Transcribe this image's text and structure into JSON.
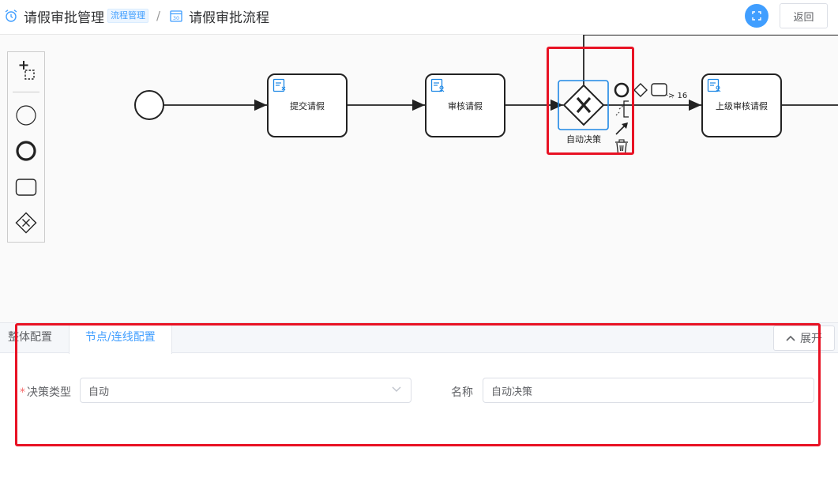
{
  "breadcrumb": {
    "title": "请假审批管理",
    "tag": "流程管理",
    "separator": "/",
    "current": "请假审批流程"
  },
  "header": {
    "back_label": "返回"
  },
  "diagram": {
    "nodes": {
      "task1": "提交请假",
      "task2": "审核请假",
      "gateway": "自动决策",
      "task3": "上级审核请假"
    },
    "context_pad_count": "> 16"
  },
  "palette": {
    "tools": [
      "hand-tool-icon",
      "start-event-icon",
      "end-event-icon",
      "task-icon",
      "gateway-icon"
    ]
  },
  "panel": {
    "tabs": [
      "整体配置",
      "节点/连线配置"
    ],
    "active_tab": "节点/连线配置",
    "expand_label": "展开",
    "decision_type_label": "决策类型",
    "decision_type_value": "自动",
    "name_label": "名称",
    "name_value": "自动决策"
  },
  "colors": {
    "accent": "#409eff",
    "highlight": "#e81224",
    "selected": "#1e88e5"
  }
}
